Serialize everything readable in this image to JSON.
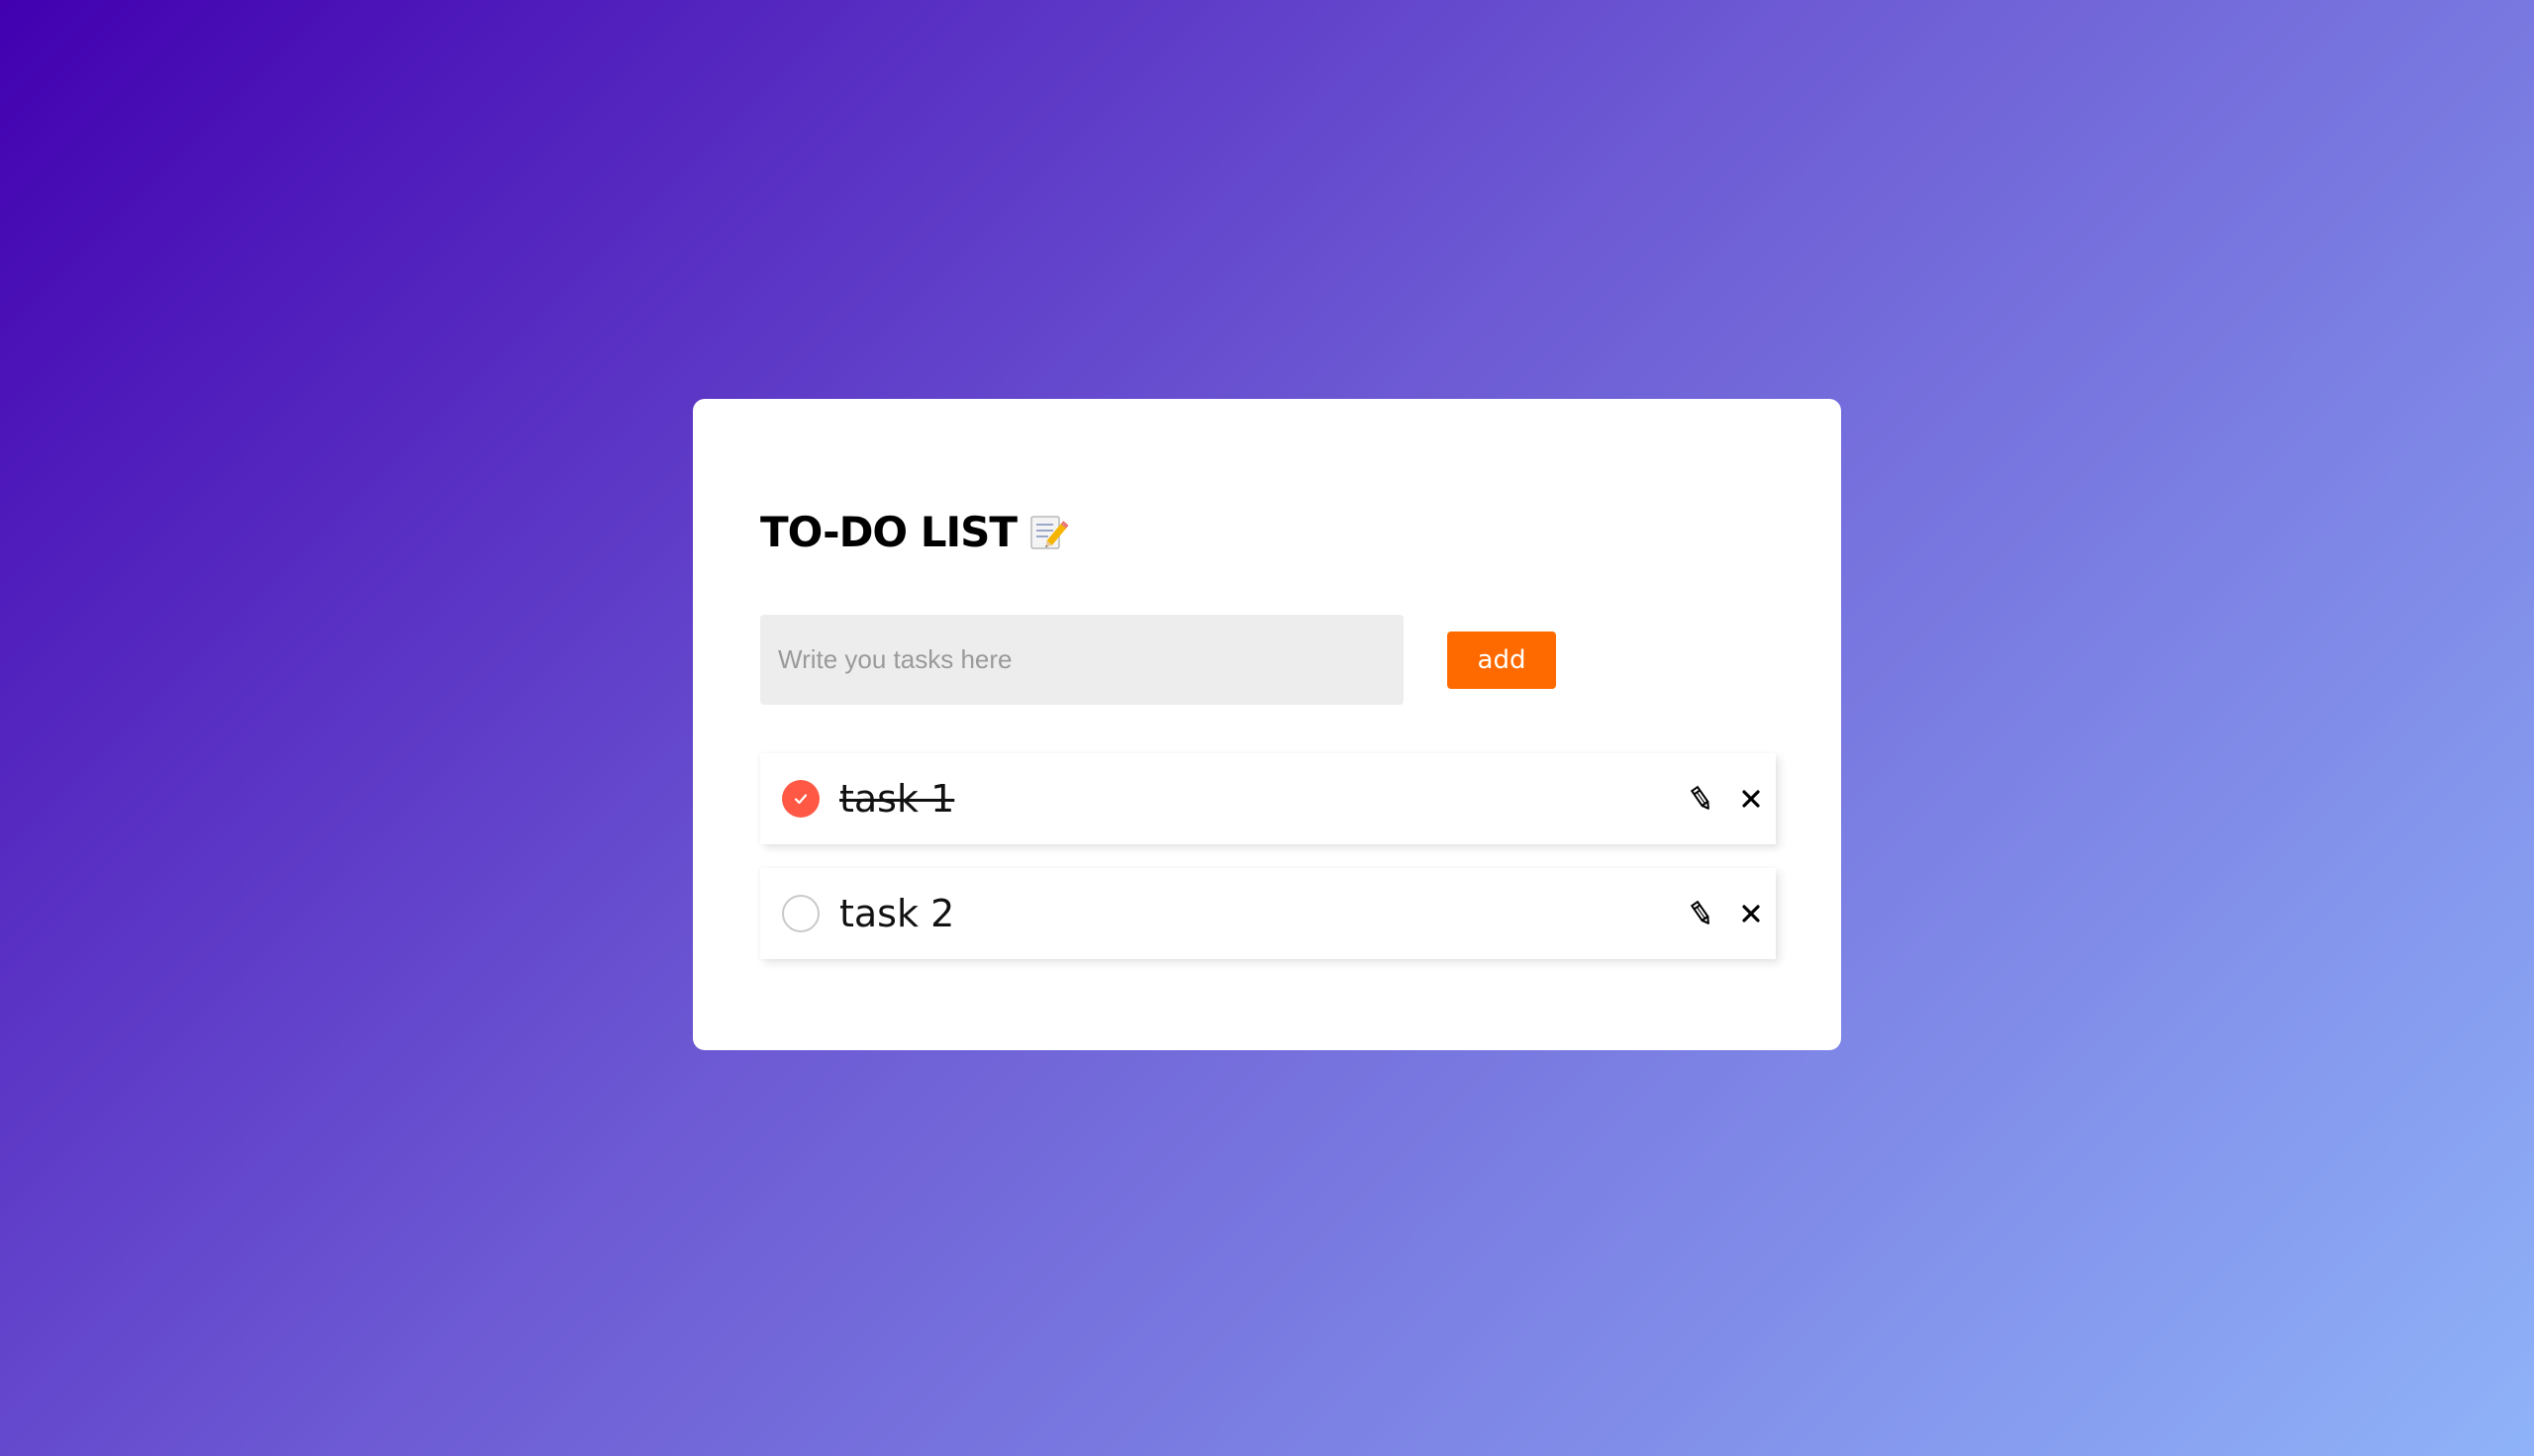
{
  "app": {
    "title": "TO-DO LIST",
    "title_icon": "memo-pencil-icon"
  },
  "input": {
    "value": "",
    "placeholder": "Write you tasks here"
  },
  "add_button": {
    "label": "add"
  },
  "tasks": [
    {
      "text": "task 1",
      "completed": true,
      "edit_icon": "pencil-icon",
      "delete_icon": "close-icon"
    },
    {
      "text": "task 2",
      "completed": false,
      "edit_icon": "pencil-icon",
      "delete_icon": "close-icon"
    }
  ],
  "colors": {
    "accent": "#ff6a00",
    "checked": "#ff5945",
    "input_bg": "#ededed",
    "gradient_start": "#4200b0",
    "gradient_end": "#8fb3f8"
  }
}
